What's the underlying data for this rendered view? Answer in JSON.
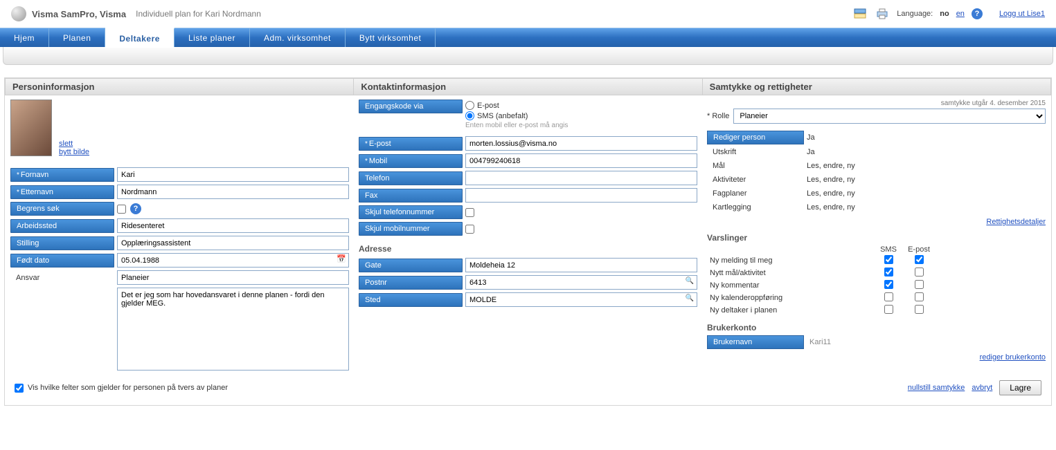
{
  "header": {
    "app_title": "Visma SamPro, Visma",
    "subtitle": "Individuell plan for Kari Nordmann",
    "language_label": "Language:",
    "lang_no": "no",
    "lang_en": "en",
    "logout": "Logg ut Lise1"
  },
  "tabs": {
    "hjem": "Hjem",
    "planen": "Planen",
    "deltakere": "Deltakere",
    "liste": "Liste planer",
    "adm": "Adm. virksomhet",
    "bytt": "Bytt virksomhet"
  },
  "sections": {
    "person": "Personinformasjon",
    "kontakt": "Kontaktinformasjon",
    "samtykke": "Samtykke og rettigheter"
  },
  "img": {
    "slett": "slett",
    "bytt": "bytt bilde"
  },
  "person": {
    "fornavn_l": "Fornavn",
    "fornavn_v": "Kari",
    "etternavn_l": "Etternavn",
    "etternavn_v": "Nordmann",
    "begrens_l": "Begrens søk",
    "arbeidssted_l": "Arbeidssted",
    "arbeidssted_v": "Ridesenteret",
    "stilling_l": "Stilling",
    "stilling_v": "Opplæringsassistent",
    "fodt_l": "Født dato",
    "fodt_v": "05.04.1988",
    "ansvar_l": "Ansvar",
    "ansvar_v": "Planeier",
    "ansvar_text": "Det er jeg som har hovedansvaret i denne planen - fordi den gjelder MEG."
  },
  "kontakt": {
    "engangs_l": "Engangskode via",
    "radio_epost": "E-post",
    "radio_sms": "SMS (anbefalt)",
    "hint": "Enten mobil eller e-post må angis",
    "epost_l": "E-post",
    "epost_v": "morten.lossius@visma.no",
    "mobil_l": "Mobil",
    "mobil_v": "004799240618",
    "telefon_l": "Telefon",
    "telefon_v": "",
    "fax_l": "Fax",
    "fax_v": "",
    "skjul_tel_l": "Skjul telefonnummer",
    "skjul_mob_l": "Skjul mobilnummer",
    "adresse_h": "Adresse",
    "gate_l": "Gate",
    "gate_v": "Moldeheia 12",
    "postnr_l": "Postnr",
    "postnr_v": "6413",
    "sted_l": "Sted",
    "sted_v": "MOLDE"
  },
  "samtykke": {
    "expiry": "samtykke utgår 4. desember 2015",
    "rolle_l": "* Rolle",
    "rolle_v": "Planeier",
    "perms": {
      "rediger": {
        "l": "Rediger person",
        "v": "Ja"
      },
      "utskrift": {
        "l": "Utskrift",
        "v": "Ja"
      },
      "maal": {
        "l": "Mål",
        "v": "Les, endre, ny"
      },
      "akt": {
        "l": "Aktiviteter",
        "v": "Les, endre, ny"
      },
      "fag": {
        "l": "Fagplaner",
        "v": "Les, endre, ny"
      },
      "kart": {
        "l": "Kartlegging",
        "v": "Les, endre, ny"
      }
    },
    "rettighets_link": "Rettighetsdetaljer",
    "varslinger_h": "Varslinger",
    "col_sms": "SMS",
    "col_epost": "E-post",
    "notes": {
      "n1": "Ny melding til meg",
      "n2": "Nytt mål/aktivitet",
      "n3": "Ny kommentar",
      "n4": "Ny kalenderoppføring",
      "n5": "Ny deltaker i planen"
    },
    "brukerkonto_h": "Brukerkonto",
    "brukernavn_l": "Brukernavn",
    "brukernavn_v": "Kari11",
    "rediger_bruker_link": "rediger brukerkonto"
  },
  "footer": {
    "vis_felter": "Vis hvilke felter som gjelder for personen på tvers av planer",
    "nullstill": "nullstill samtykke",
    "avbryt": "avbryt",
    "lagre": "Lagre"
  }
}
